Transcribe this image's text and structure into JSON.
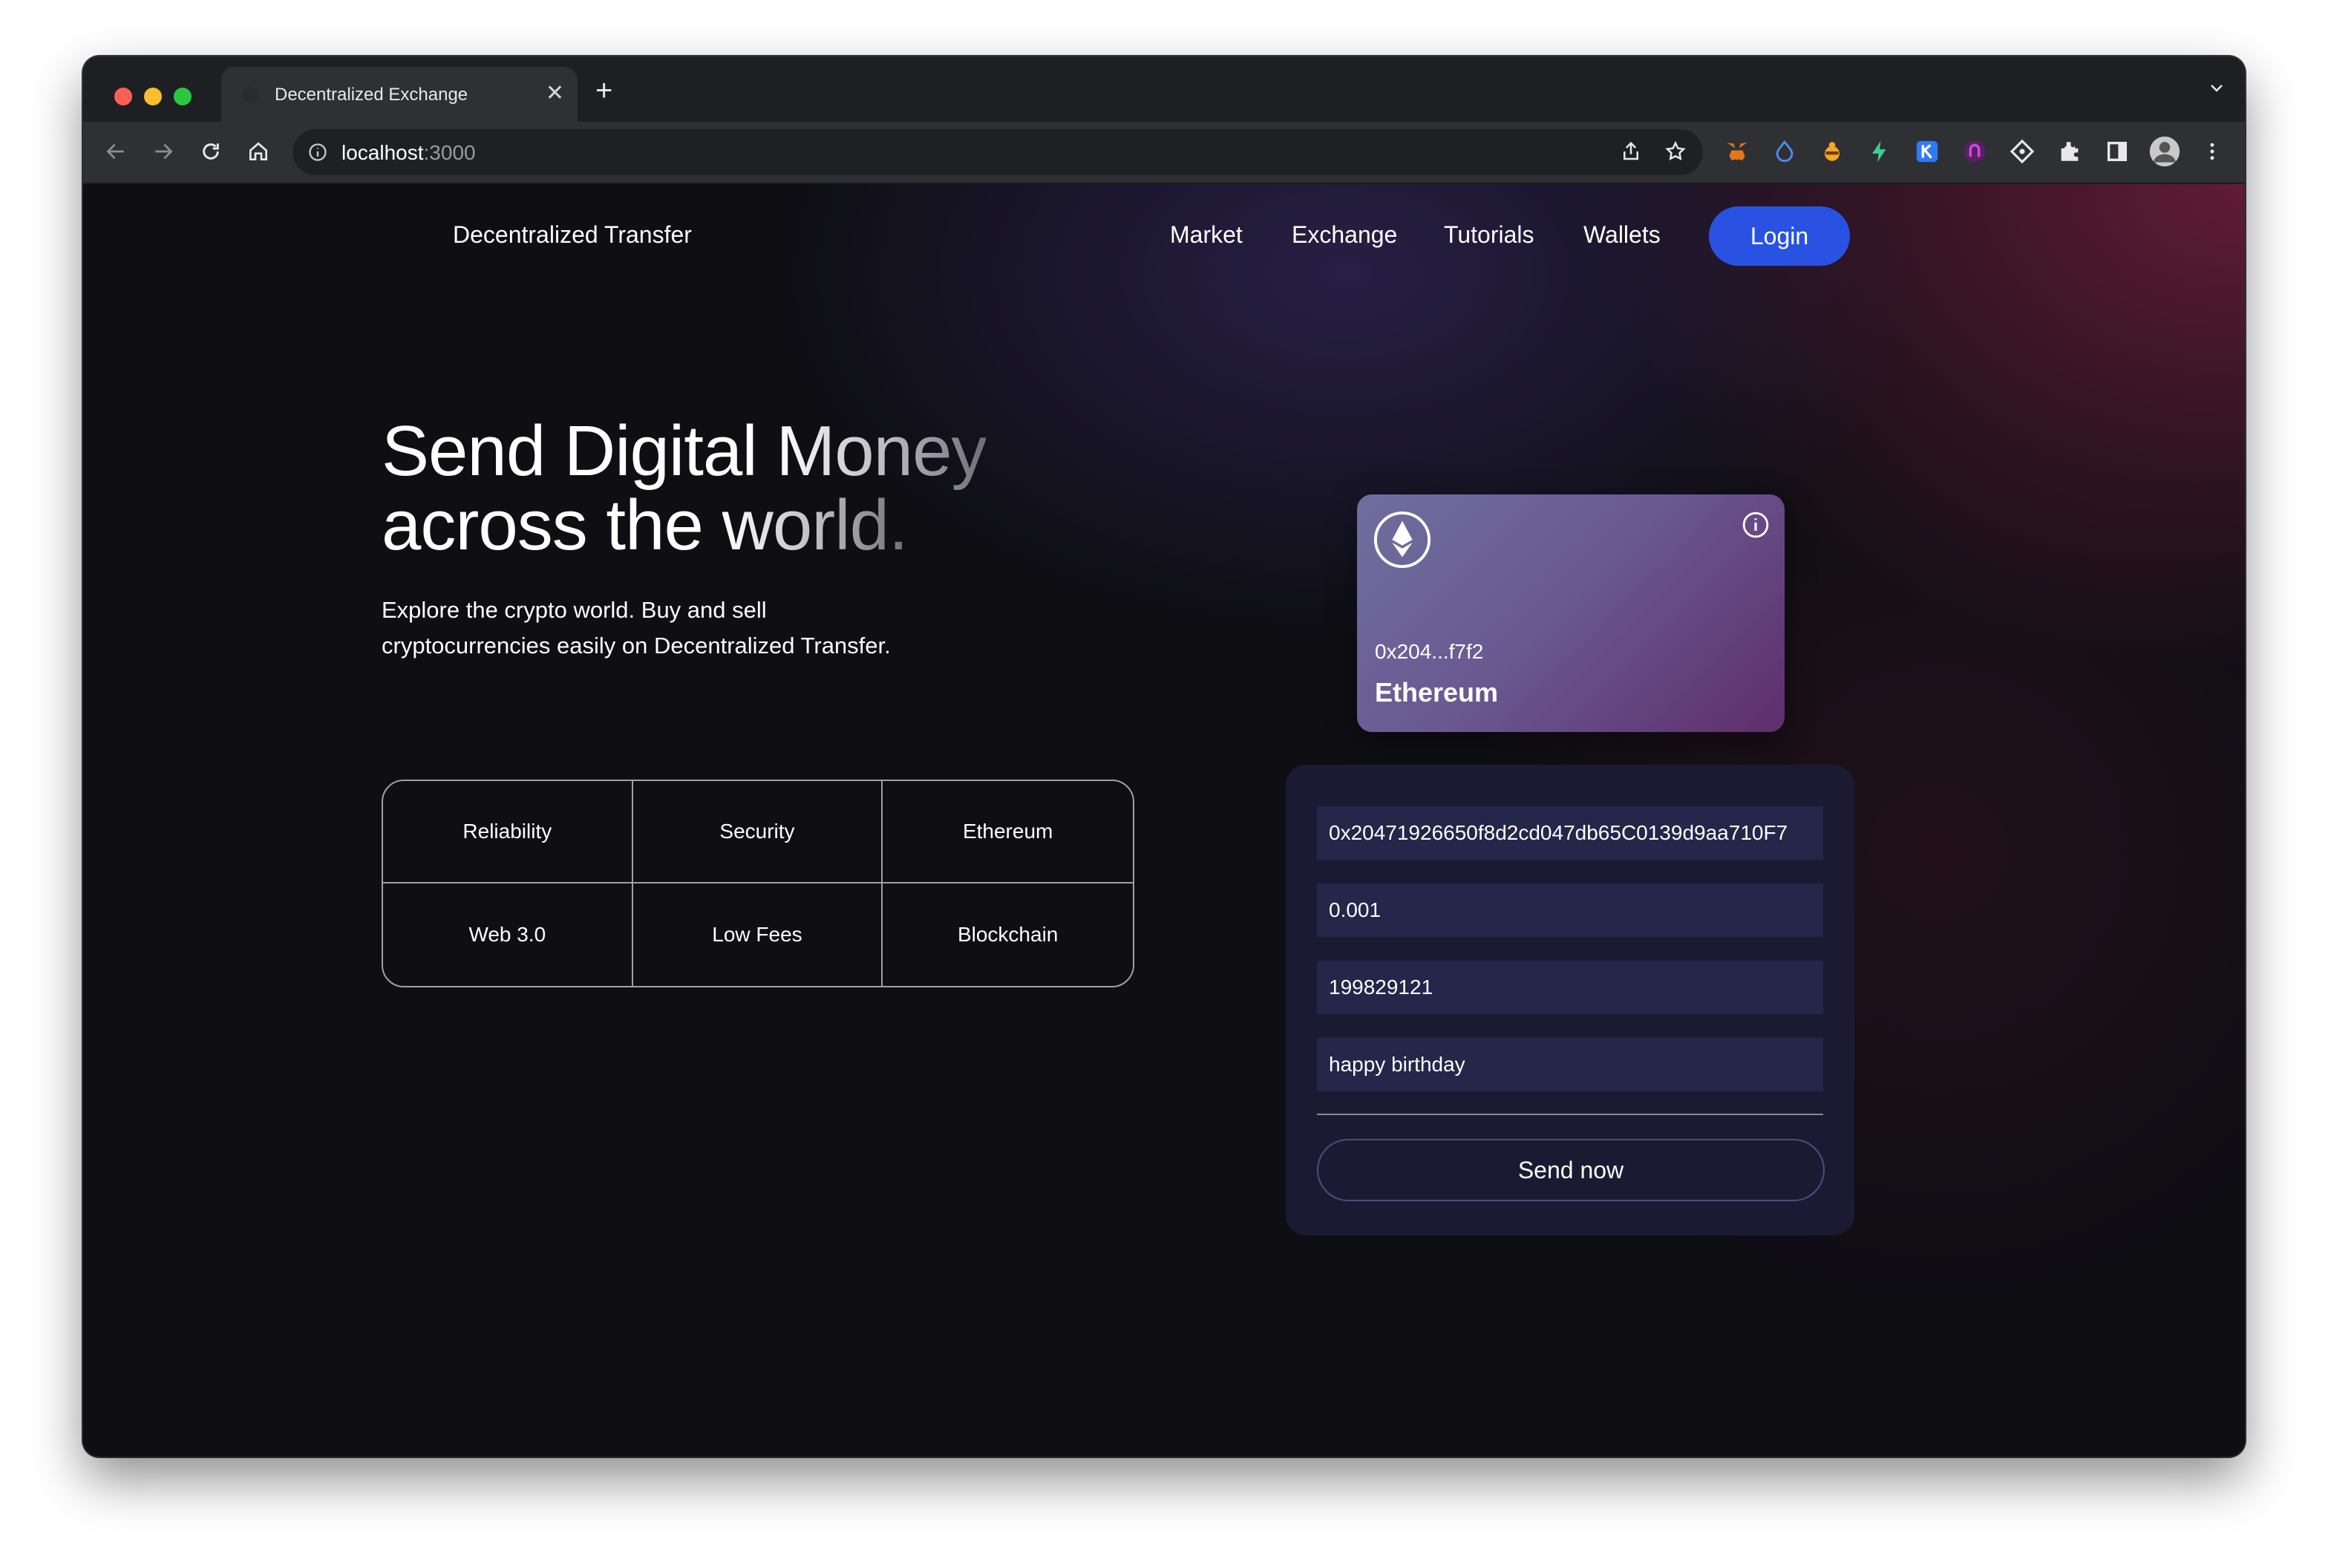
{
  "browser": {
    "tab_title": "Decentralized Exchange",
    "url_host": "localhost",
    "url_port": ":3000"
  },
  "page": {
    "brand": "Decentralized Transfer",
    "nav": [
      "Market",
      "Exchange",
      "Tutorials",
      "Wallets"
    ],
    "login_label": "Login",
    "hero": {
      "title_line1_a": "Send Digital ",
      "title_line1_b": "Money",
      "title_line2_a": "across the ",
      "title_line2_b": "world.",
      "subtitle_line1": "Explore the crypto world. Buy and sell",
      "subtitle_line2": "cryptocurrencies easily on Decentralized Transfer."
    },
    "features": [
      "Reliability",
      "Security",
      "Ethereum",
      "Web 3.0",
      "Low Fees",
      "Blockchain"
    ],
    "card": {
      "address": "0x204...f7f2",
      "network": "Ethereum"
    },
    "form": {
      "address_value": "0x20471926650f8d2cd047db65C0139d9aa710F7",
      "amount_value": "0.001",
      "keyword_value": "199829121",
      "message_value": "happy birthday",
      "send_label": "Send now"
    }
  },
  "colors": {
    "accent_blue": "#2952e3",
    "form_bg": "#1a1b33",
    "field_bg": "#24264a",
    "page_bg": "#0e0e13"
  },
  "icons": {
    "nav": [
      "back-arrow-icon",
      "forward-arrow-icon",
      "reload-icon",
      "home-icon"
    ],
    "extensions": [
      "metamask-icon",
      "drop-icon",
      "bee-icon",
      "bolt-icon",
      "k-icon",
      "magnet-icon",
      "diamond-icon",
      "puzzle-icon",
      "sidepanel-icon"
    ]
  }
}
